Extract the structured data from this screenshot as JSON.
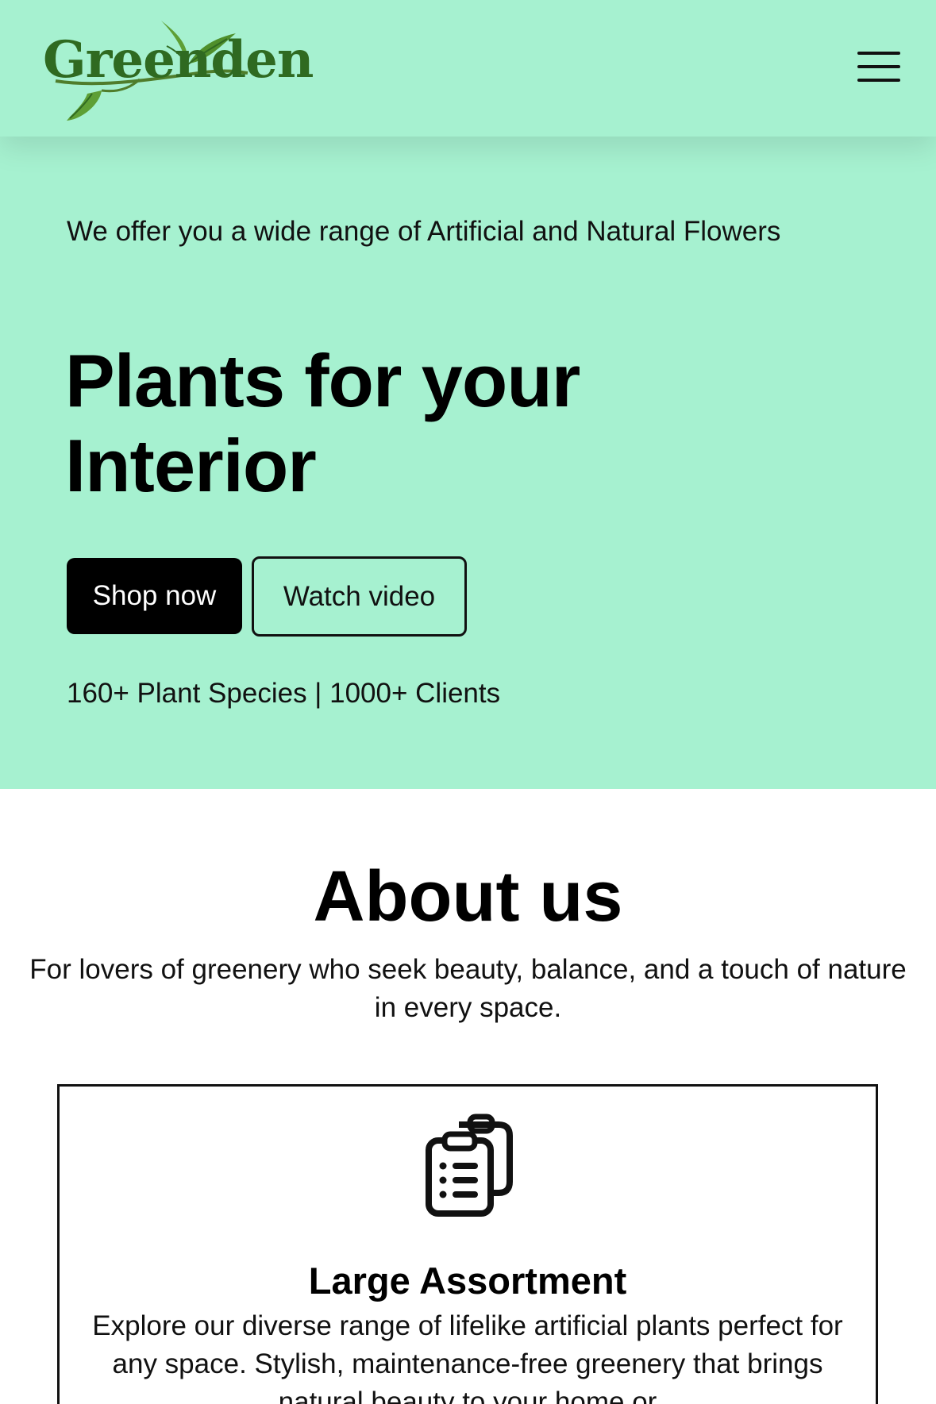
{
  "header": {
    "logo_text": "Greenden",
    "logo_icon": "leaf-logo",
    "menu_icon": "hamburger-menu-icon"
  },
  "hero": {
    "subtitle": "We offer you a wide range of Artificial and Natural Flowers",
    "title": "Plants for your Interior",
    "shop_label": "Shop now",
    "video_label": "Watch video",
    "stats": "160+ Plant Species | 1000+ Clients"
  },
  "about": {
    "title": "About us",
    "subtitle": "For lovers of greenery who seek beauty, balance, and a touch of nature in every space.",
    "card": {
      "icon": "clipboard-list-icon",
      "title": "Large Assortment",
      "text": "Explore our diverse range of lifelike artificial plants perfect for any space. Stylish, maintenance-free greenery that brings natural beauty to your home or"
    }
  },
  "colors": {
    "hero_bg": "#a6f1d0",
    "logo_green": "#2f6a21",
    "button_dark": "#000000"
  }
}
